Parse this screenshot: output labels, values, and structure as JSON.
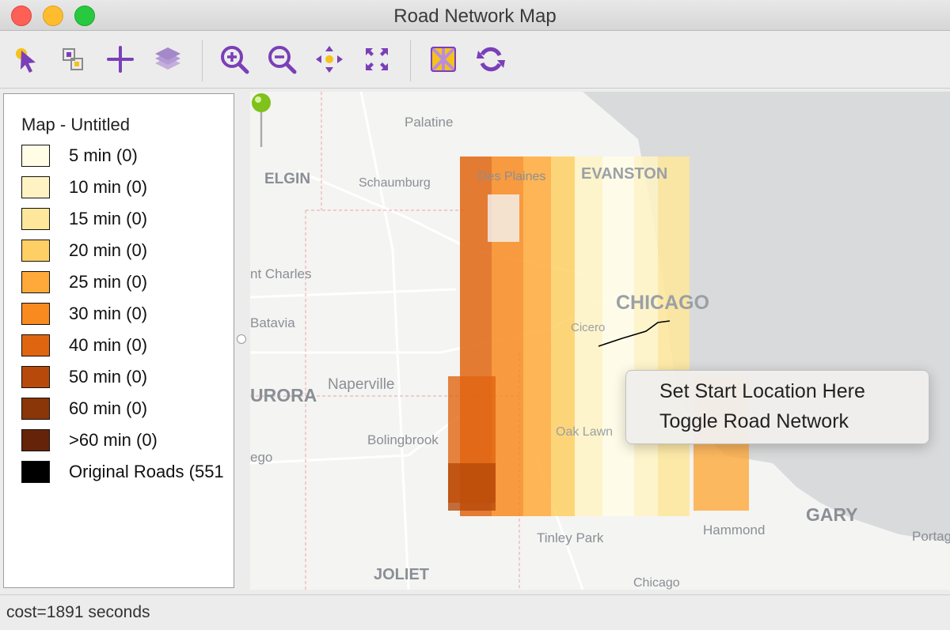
{
  "window": {
    "title": "Road Network Map"
  },
  "toolbar": {
    "buttons": [
      {
        "name": "select-tool",
        "icon": "select-arrow-icon"
      },
      {
        "name": "select-region-tool",
        "icon": "select-region-icon"
      },
      {
        "name": "add-layer",
        "icon": "plus-icon"
      },
      {
        "name": "layers",
        "icon": "layers-icon"
      },
      {
        "name": "zoom-in",
        "icon": "zoom-in-icon"
      },
      {
        "name": "zoom-out",
        "icon": "zoom-out-icon"
      },
      {
        "name": "pan",
        "icon": "pan-icon"
      },
      {
        "name": "full-extent",
        "icon": "full-extent-icon"
      },
      {
        "name": "basemap",
        "icon": "basemap-icon"
      },
      {
        "name": "refresh",
        "icon": "refresh-icon"
      }
    ],
    "icon_color": "#7a3fb8"
  },
  "legend": {
    "title": "Map - Untitled",
    "items": [
      {
        "label": "5 min (0)",
        "color": "#fffde6"
      },
      {
        "label": "10 min (0)",
        "color": "#fff3c4"
      },
      {
        "label": "15 min (0)",
        "color": "#fee69a"
      },
      {
        "label": "20 min (0)",
        "color": "#fecf64"
      },
      {
        "label": "25 min (0)",
        "color": "#fea93a"
      },
      {
        "label": "30 min (0)",
        "color": "#f88a20"
      },
      {
        "label": "40 min (0)",
        "color": "#e06510"
      },
      {
        "label": "50 min (0)",
        "color": "#b74a0a"
      },
      {
        "label": "60 min (0)",
        "color": "#8a3608"
      },
      {
        "label": ">60 min (0)",
        "color": "#652309"
      },
      {
        "label": "Original Roads (551",
        "color": "#000000"
      }
    ]
  },
  "map": {
    "labels": [
      "Palatine",
      "ELGIN",
      "Schaumburg",
      "Des Plaines",
      "EVANSTON",
      "nt Charles",
      "CHICAGO",
      "Cicero",
      "Batavia",
      "URORA",
      "Naperville",
      "Bolingbrook",
      "ego",
      "Oak Lawn",
      "GARY",
      "Hammond",
      "Portag",
      "Tinley Park",
      "JOLIET",
      "Chicago"
    ]
  },
  "context_menu": {
    "items": [
      "Set Start Location Here",
      "Toggle Road Network"
    ]
  },
  "status": {
    "text": "cost=1891 seconds"
  }
}
